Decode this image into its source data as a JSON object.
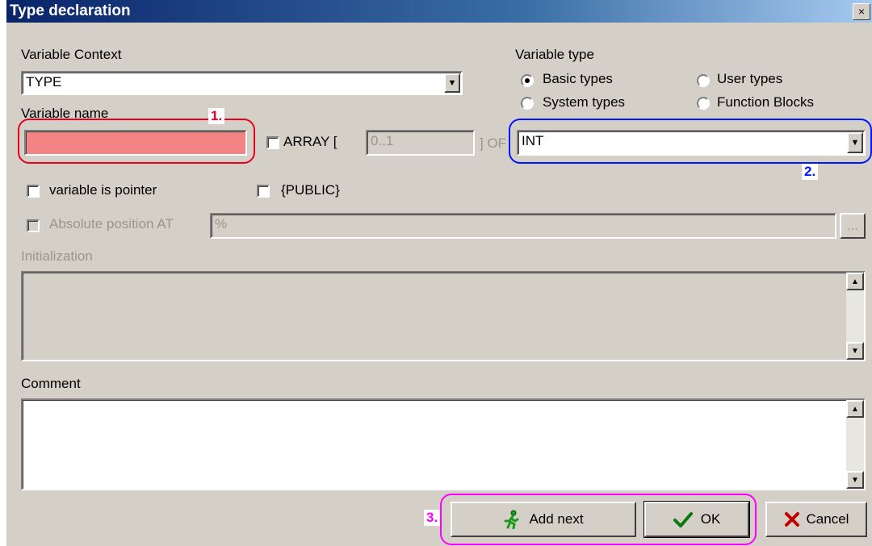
{
  "window": {
    "title": "Type declaration",
    "close_glyph": "×"
  },
  "variable_context": {
    "label": "Variable Context",
    "value": "TYPE"
  },
  "variable_type": {
    "label": "Variable type",
    "options": [
      {
        "label": "Basic types",
        "selected": true
      },
      {
        "label": "User types",
        "selected": false
      },
      {
        "label": "System types",
        "selected": false
      },
      {
        "label": "Function Blocks",
        "selected": false
      }
    ]
  },
  "variable_name": {
    "label": "Variable name",
    "value": ""
  },
  "array": {
    "label": "ARRAY [",
    "range": "0..1",
    "of_label": "] OF"
  },
  "type_select": {
    "value": "INT"
  },
  "pointer": {
    "label": "variable is pointer"
  },
  "public": {
    "label": "{PUBLIC}"
  },
  "absolute": {
    "label": "Absolute position AT",
    "value": "%",
    "browse_label": "..."
  },
  "initialization": {
    "label": "Initialization"
  },
  "comment": {
    "label": "Comment"
  },
  "buttons": {
    "add_next": "Add next",
    "ok": "OK",
    "cancel": "Cancel"
  },
  "annotations": {
    "one": "1.",
    "two": "2.",
    "three": "3."
  },
  "colors": {
    "red_outline": "#e8001c",
    "blue_outline": "#0018ff",
    "magenta_outline": "#ff00ff",
    "name_field_fill": "#f48484"
  }
}
